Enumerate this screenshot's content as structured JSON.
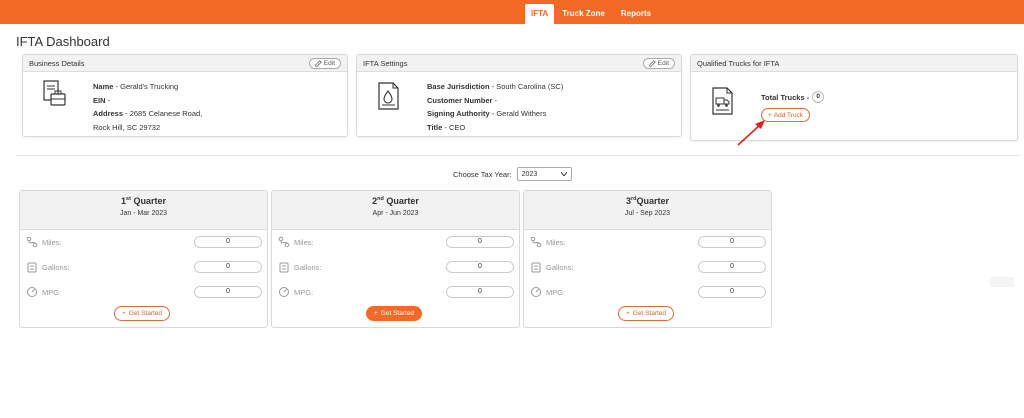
{
  "nav": {
    "items": [
      "IFTA",
      "Truck Zone",
      "Reports"
    ]
  },
  "page": {
    "title": "IFTA Dashboard"
  },
  "business": {
    "header": "Business Details",
    "edit_label": "Edit",
    "name_label": "Name",
    "name_value": "Gerald's Trucking",
    "ein_label": "EIN",
    "ein_value": "",
    "address_label": "Address",
    "address_line1": "2685 Celanese Road,",
    "address_line2": "Rock Hill, SC 29732"
  },
  "ifta_settings": {
    "header": "IFTA Settings",
    "edit_label": "Edit",
    "base_label": "Base Jurisdiction",
    "base_value": "South Carolina (SC)",
    "customer_label": "Customer Number",
    "customer_value": "",
    "signing_label": "Signing Authority",
    "signing_value": "Gerald Withers",
    "title_label": "Title",
    "title_value": "CEO"
  },
  "trucks": {
    "header": "Qualified Trucks for IFTA",
    "total_label": "Total Trucks -",
    "total_value": "0",
    "add_label": "Add Truck"
  },
  "tax_year": {
    "label": "Choose Tax Year:",
    "selected": "2023"
  },
  "quarters": [
    {
      "title_prefix": "1",
      "title_sup": "st",
      "title_suffix": " Quarter",
      "range": "Jan - Mar 2023",
      "miles_label": "Miles:",
      "miles": "0",
      "gallons_label": "Gallons:",
      "gallons": "0",
      "mpg_label": "MPG:",
      "mpg": "0",
      "button": "Get Started"
    },
    {
      "title_prefix": "2",
      "title_sup": "nd",
      "title_suffix": " Quarter",
      "range": "Apr - Jun 2023",
      "miles_label": "Miles:",
      "miles": "0",
      "gallons_label": "Gallons:",
      "gallons": "0",
      "mpg_label": "MPG:",
      "mpg": "0",
      "button": "Get Started"
    },
    {
      "title_prefix": "3",
      "title_sup": "rd",
      "title_suffix": "Quarter",
      "range": "Jul - Sep 2023",
      "miles_label": "Miles:",
      "miles": "0",
      "gallons_label": "Gallons:",
      "gallons": "0",
      "mpg_label": "MPG:",
      "mpg": "0",
      "button": "Get Started"
    }
  ],
  "colors": {
    "accent": "#f26a26",
    "annotation_arrow": "#e02020"
  }
}
